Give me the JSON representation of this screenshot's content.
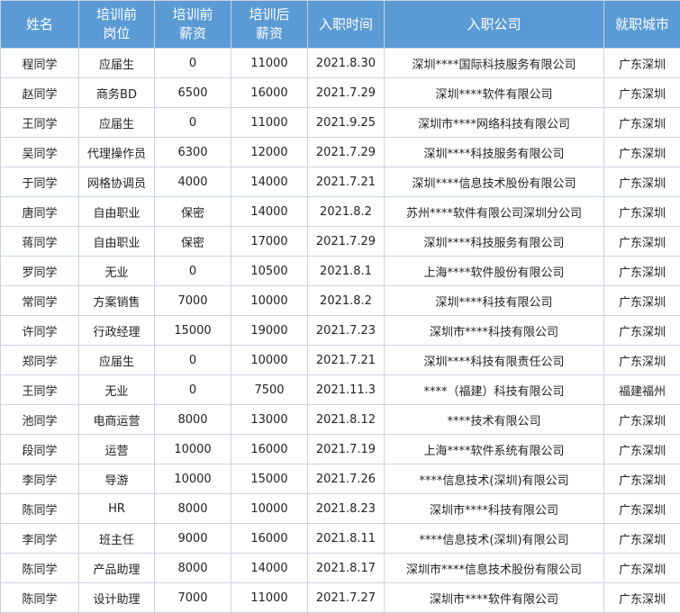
{
  "headers": [
    "姓名",
    "培训前\n岗位",
    "培训前\n薪资",
    "培训后\n薪资",
    "入职时间",
    "入职公司",
    "就职城市"
  ],
  "rows": [
    [
      "程同学",
      "应届生",
      "0",
      "11000",
      "2021.8.30",
      "深圳****国际科技服务有限公司",
      "广东深圳"
    ],
    [
      "赵同学",
      "商务BD",
      "6500",
      "16000",
      "2021.7.29",
      "深圳****软件有限公司",
      "广东深圳"
    ],
    [
      "王同学",
      "应届生",
      "0",
      "11000",
      "2021.9.25",
      "深圳市****网络科技有限公司",
      "广东深圳"
    ],
    [
      "吴同学",
      "代理操作员",
      "6300",
      "12000",
      "2021.7.29",
      "深圳****科技服务有限公司",
      "广东深圳"
    ],
    [
      "于同学",
      "网格协调员",
      "4000",
      "14000",
      "2021.7.21",
      "深圳****信息技术股份有限公司",
      "广东深圳"
    ],
    [
      "唐同学",
      "自由职业",
      "保密",
      "14000",
      "2021.8.2",
      "苏州****软件有限公司深圳分公司",
      "广东深圳"
    ],
    [
      "蒋同学",
      "自由职业",
      "保密",
      "17000",
      "2021.7.29",
      "深圳****科技服务有限公司",
      "广东深圳"
    ],
    [
      "罗同学",
      "无业",
      "0",
      "10500",
      "2021.8.1",
      "上海****软件股份有限公司",
      "广东深圳"
    ],
    [
      "常同学",
      "方案销售",
      "7000",
      "10000",
      "2021.8.2",
      "深圳****科技有限公司",
      "广东深圳"
    ],
    [
      "许同学",
      "行政经理",
      "15000",
      "19000",
      "2021.7.23",
      "深圳市****科技有限公司",
      "广东深圳"
    ],
    [
      "郑同学",
      "应届生",
      "0",
      "10000",
      "2021.7.21",
      "深圳****科技有限责任公司",
      "广东深圳"
    ],
    [
      "王同学",
      "无业",
      "0",
      "7500",
      "2021.11.3",
      "****（福建）科技有限公司",
      "福建福州"
    ],
    [
      "池同学",
      "电商运营",
      "8000",
      "13000",
      "2021.8.12",
      "****技术有限公司",
      "广东深圳"
    ],
    [
      "段同学",
      "运营",
      "10000",
      "16000",
      "2021.7.19",
      "上海****软件系统有限公司",
      "广东深圳"
    ],
    [
      "李同学",
      "导游",
      "10000",
      "15000",
      "2021.7.26",
      "****信息技术(深圳)有限公司",
      "广东深圳"
    ],
    [
      "陈同学",
      "HR",
      "8000",
      "10000",
      "2021.8.23",
      "深圳市****科技有限公司",
      "广东深圳"
    ],
    [
      "李同学",
      "班主任",
      "9000",
      "16000",
      "2021.8.11",
      "****信息技术(深圳)有限公司",
      "广东深圳"
    ],
    [
      "陈同学",
      "产品助理",
      "8000",
      "14000",
      "2021.8.17",
      "深圳市****信息技术股份有限公司",
      "广东深圳"
    ],
    [
      "陈同学",
      "设计助理",
      "7000",
      "11000",
      "2021.7.27",
      "深圳市****软件有限公司",
      "广东深圳"
    ]
  ],
  "colors": {
    "header_bg": "#5b9bd5",
    "header_text": "#ffffff",
    "border": "#c9d3de",
    "cell_text": "#222222"
  }
}
